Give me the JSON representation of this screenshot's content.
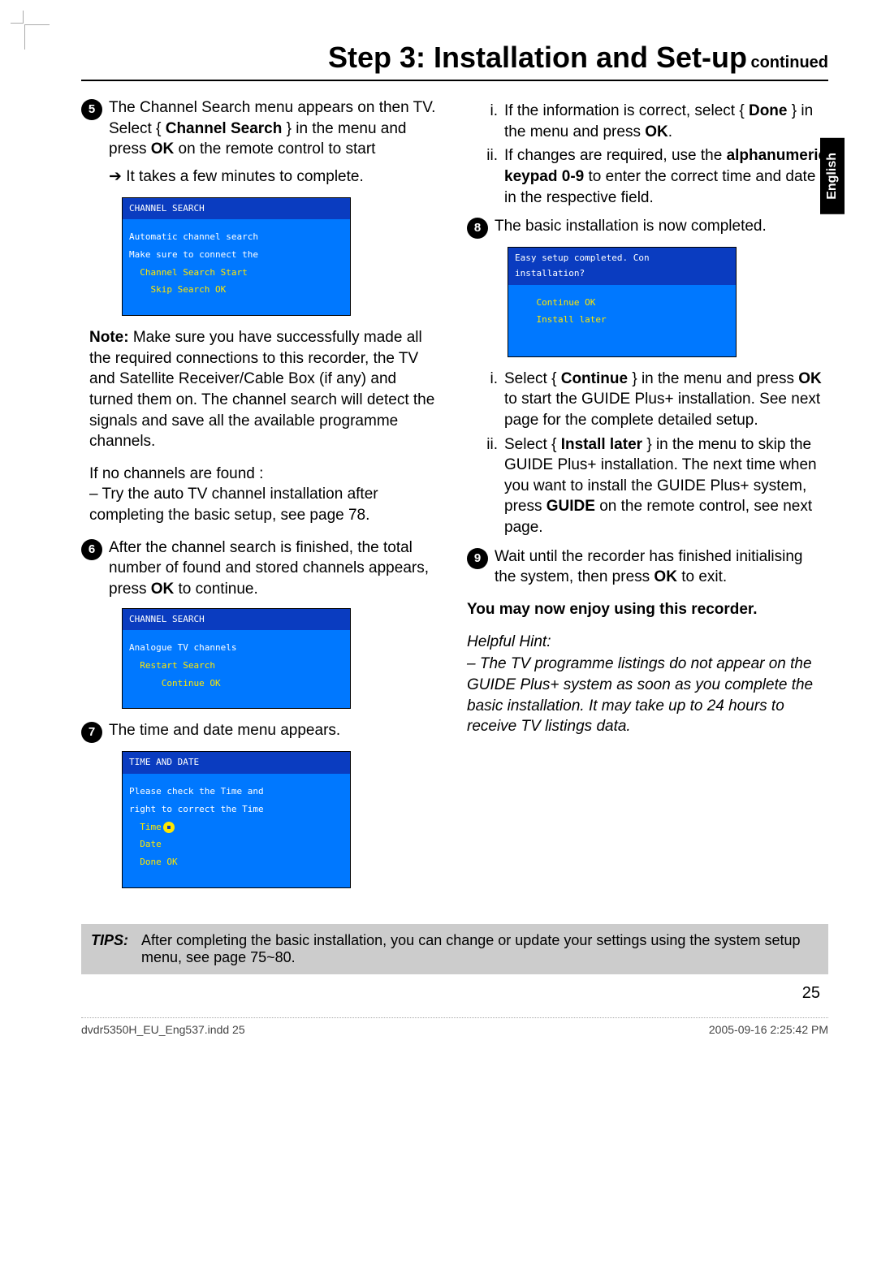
{
  "header": {
    "title": "Step 3: Installation and Set-up",
    "continued": "continued"
  },
  "lang_tab": "English",
  "left": {
    "step5": {
      "num": "5",
      "text_a": "The Channel Search menu appears on then TV. Select { ",
      "text_b": "Channel Search",
      "text_c": " } in the menu and press ",
      "text_d": "OK",
      "text_e": " on the remote control to start",
      "arrow": "It takes a few minutes to complete."
    },
    "osd1": {
      "title": "CHANNEL SEARCH",
      "l1": "Automatic channel search",
      "l2": "Make sure to connect the",
      "y1": "Channel Search   Start",
      "y2": "Skip Search      OK"
    },
    "note": {
      "label": "Note:",
      "text": " Make sure you have successfully made all the required connections to this recorder, the TV and Satellite Receiver/Cable Box (if any) and turned them on. The channel search will detect the signals and save all the available programme channels."
    },
    "nochan": {
      "line1": "If no channels are found :",
      "line2": "– Try the auto TV channel installation after completing the basic setup, see page 78."
    },
    "step6": {
      "num": "6",
      "text_a": "After the channel search is finished, the total number of found and stored channels appears, press ",
      "text_b": "OK",
      "text_c": " to continue."
    },
    "osd2": {
      "title": "CHANNEL SEARCH",
      "l1": "Analogue TV channels",
      "y1": "Restart Search",
      "y2": "Continue   OK"
    },
    "step7": {
      "num": "7",
      "text": "The time and date menu appears."
    },
    "osd3": {
      "title": "TIME AND DATE",
      "l1": "Please check the Time and",
      "l2": "right to correct the Time",
      "y1": "Time",
      "y2": "Date",
      "y3": "Done        OK"
    }
  },
  "right": {
    "sub_i": {
      "roman": "i.",
      "a": "If the information is correct, select { ",
      "b": "Done",
      "c": " } in the menu and press ",
      "d": "OK",
      "e": "."
    },
    "sub_ii": {
      "roman": "ii.",
      "a": "If changes are required, use the ",
      "b": "alphanumeric keypad 0-9",
      "c": " to enter the correct time and date in the respective field."
    },
    "step8": {
      "num": "8",
      "text": "The basic installation is now completed."
    },
    "osd4": {
      "title": "Easy setup completed. Con",
      "l1": "installation?",
      "y1": "Continue   OK",
      "y2": "Install later"
    },
    "sub8_i": {
      "roman": "i.",
      "a": "Select { ",
      "b": "Continue",
      "c": " } in the menu and press ",
      "d": "OK",
      "e": " to start the GUIDE Plus+ installation. See next page for the complete detailed setup."
    },
    "sub8_ii": {
      "roman": "ii.",
      "a": "Select { ",
      "b": "Install later",
      "c": " } in the menu to skip the GUIDE Plus+ installation. The next time when you want to install the GUIDE Plus+ system, press ",
      "d": "GUIDE",
      "e": " on the remote control, see next page."
    },
    "step9": {
      "num": "9",
      "a": "Wait until the recorder has finished initialising the system, then press ",
      "b": "OK",
      "c": " to exit."
    },
    "enjoy": "You may now enjoy using this recorder.",
    "hint_label": "Helpful Hint:",
    "hint_body": "– The TV programme listings do not appear on the GUIDE Plus+ system as soon as you complete the basic installation. It may take up to 24 hours to receive TV listings data."
  },
  "tips": {
    "label": "TIPS:",
    "text": "After completing the basic installation, you can change or update your settings using the system setup menu, see page 75~80."
  },
  "page_num": "25",
  "footer": {
    "left": "dvdr5350H_EU_Eng537.indd   25",
    "right": "2005-09-16   2:25:42 PM"
  }
}
